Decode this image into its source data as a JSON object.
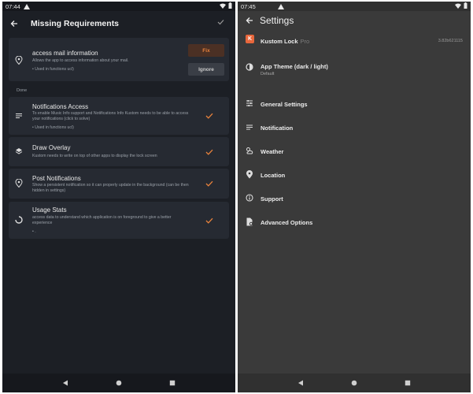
{
  "left": {
    "status_time": "07:44",
    "title": "Missing Requirements",
    "pending_card": {
      "title": "access mail information",
      "desc": "Allows the app to access information about your mail.",
      "used": "• Used in functions ucl)",
      "fix_label": "Fix",
      "ignore_label": "Ignore"
    },
    "done_label": "Done",
    "done_items": [
      {
        "title": "Notifications Access",
        "desc": "To enable Music Info support and Notifications Info Kustom needs to be able to access your notifications (click to solve)",
        "used": "• Used in functions ucl)"
      },
      {
        "title": "Draw Overlay",
        "desc": "Kustom needs to write on top of other apps to display the lock screen",
        "used": ""
      },
      {
        "title": "Post Notifications",
        "desc": "Show a persistent notification so it can properly update in the background (can be then hidden in settings)",
        "used": ""
      },
      {
        "title": "Usage Stats",
        "desc": "access data to understand which application is on foreground to give a better experience",
        "used": "• ."
      }
    ]
  },
  "right": {
    "status_time": "07:45",
    "title": "Settings",
    "app_name": "Kustom Lock",
    "app_pro": "Pro",
    "version": "3.82b621115",
    "theme_label": "App Theme (dark / light)",
    "theme_value": "Default",
    "items": [
      "General Settings",
      "Notification",
      "Weather",
      "Location",
      "Support",
      "Advanced Options"
    ]
  },
  "colors": {
    "accent": "#e8823c",
    "left_bg": "#1c1f25",
    "card_bg": "#262a32",
    "right_bg": "#3a3a3a"
  }
}
